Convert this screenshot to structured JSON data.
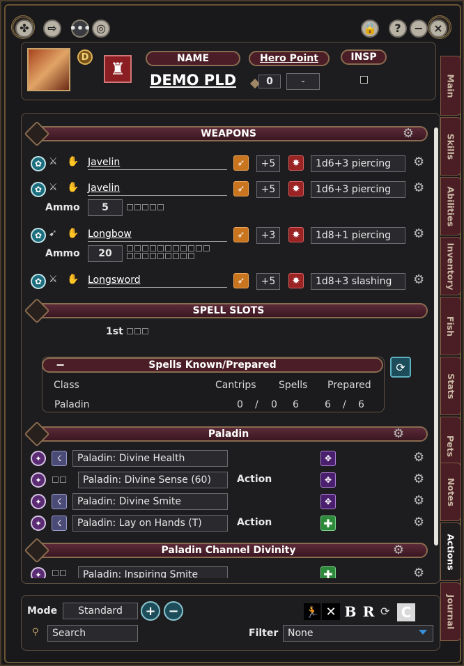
{
  "header": {
    "buttons": {
      "back": "back-icon",
      "export": "export-icon",
      "chat": "chat-icon",
      "target": "target-icon",
      "lock": "lock-icon",
      "help": "?",
      "minimize": "−",
      "close": "×"
    }
  },
  "character": {
    "badge": "D",
    "name_label": "NAME",
    "name": "DEMO PLD",
    "hero_point_label": "Hero Point",
    "hero_point_value": "0",
    "hero_point_extra": "-",
    "insp_label": "INSP"
  },
  "sections": {
    "weapons": "WEAPONS",
    "spell_slots": "SPELL SLOTS",
    "paladin": "Paladin",
    "channel": "Paladin Channel Divinity"
  },
  "weapons": [
    {
      "name": "Javelin",
      "bonus": "+5",
      "damage": "1d6+3 piercing"
    },
    {
      "name": "Javelin",
      "bonus": "+5",
      "damage": "1d6+3 piercing",
      "ammo_label": "Ammo",
      "ammo": "5"
    },
    {
      "name": "Longbow",
      "bonus": "+3",
      "damage": "1d8+1 piercing",
      "ammo_label": "Ammo",
      "ammo": "20"
    },
    {
      "name": "Longsword",
      "bonus": "+5",
      "damage": "1d8+3 slashing"
    }
  ],
  "spell_slots": {
    "level": "1st"
  },
  "spells_known": {
    "title": "Spells Known/Prepared",
    "collapse": "−",
    "headers": [
      "Class",
      "Cantrips",
      "Spells",
      "Prepared"
    ],
    "row": {
      "class": "Paladin",
      "cantrips": "0",
      "sep1": "/",
      "cantrips_max": "0",
      "spells": "6",
      "prepared": "6",
      "sep2": "/",
      "prepared_max": "6"
    }
  },
  "paladin_powers": [
    {
      "name": "Paladin: Divine Health",
      "action": ""
    },
    {
      "name": "Paladin: Divine Sense (60)",
      "action": "Action"
    },
    {
      "name": "Paladin: Divine Smite",
      "action": ""
    },
    {
      "name": "Paladin: Lay on Hands (T)",
      "action": "Action"
    }
  ],
  "channel_powers": [
    {
      "name": "Paladin: Inspiring Smite"
    }
  ],
  "footer": {
    "mode_label": "Mode",
    "mode_value": "Standard",
    "search_placeholder": "Search",
    "filter_label": "Filter",
    "filter_value": "None",
    "toggles": [
      "B",
      "R"
    ]
  },
  "tabs": [
    "Main",
    "Skills",
    "Abilities",
    "Inventory",
    "Fish",
    "Stats",
    "Pets",
    "Notes",
    "Actions",
    "Journal"
  ],
  "colors": {
    "accent": "#5c2a38",
    "border": "#8a6c50",
    "active_tab": "#201d1e"
  }
}
